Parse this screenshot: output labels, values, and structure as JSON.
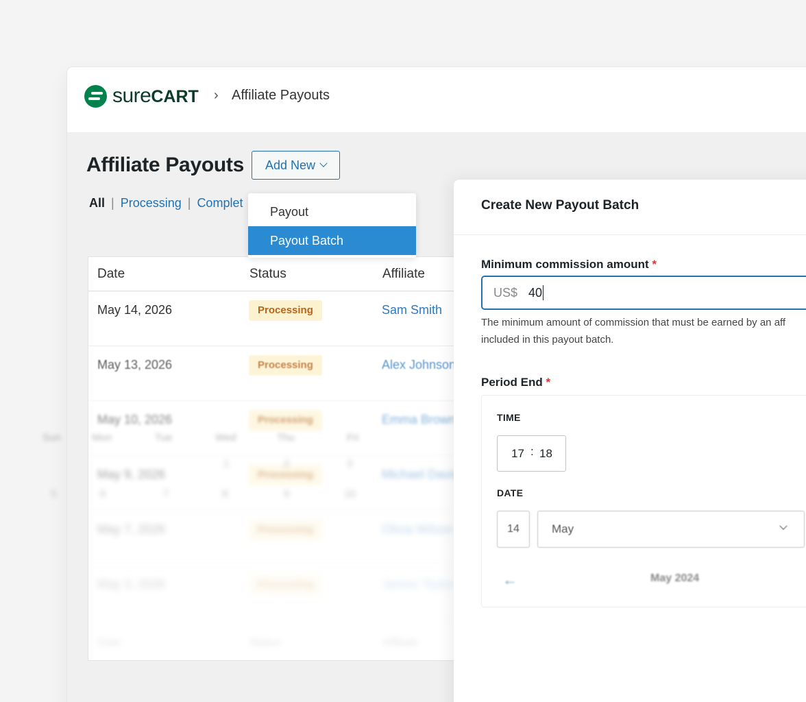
{
  "brand": {
    "name_light": "sure",
    "name_bold": "CART"
  },
  "breadcrumb": {
    "separator": "›",
    "current": "Affiliate Payouts"
  },
  "page": {
    "title": "Affiliate Payouts",
    "add_new_label": "Add New"
  },
  "filters": [
    {
      "label": "All",
      "active": true
    },
    {
      "label": "Processing",
      "active": false
    },
    {
      "label": "Complet",
      "active": false
    }
  ],
  "filter_separator": "|",
  "dropdown": {
    "items": [
      {
        "label": "Payout",
        "selected": false
      },
      {
        "label": "Payout Batch",
        "selected": true
      }
    ]
  },
  "table": {
    "columns": [
      "Date",
      "Status",
      "Affiliate"
    ],
    "rows": [
      {
        "date": "May 14, 2026",
        "status": "Processing",
        "affiliate": "Sam Smith"
      },
      {
        "date": "May 13, 2026",
        "status": "Processing",
        "affiliate": "Alex Johnson"
      },
      {
        "date": "May 10, 2026",
        "status": "Processing",
        "affiliate": "Emma Brown"
      },
      {
        "date": "May 9, 2026",
        "status": "Processing",
        "affiliate": "Michael Davis"
      },
      {
        "date": "May 7, 2026",
        "status": "Processing",
        "affiliate": "Olivia Wilson"
      },
      {
        "date": "May 3, 2026",
        "status": "Processing",
        "affiliate": "James Taylor"
      }
    ],
    "footer": [
      "Date",
      "Status",
      "Affiliate"
    ]
  },
  "modal": {
    "title": "Create New Payout Batch",
    "min_commission": {
      "label": "Minimum commission amount",
      "required_mark": "*",
      "currency_prefix": "US$",
      "value": "40",
      "help_line1": "The minimum amount of commission that must be earned by an aff",
      "help_line2": "included in this payout batch."
    },
    "period_end": {
      "label": "Period End",
      "required_mark": "*",
      "time_label": "TIME",
      "hour": "17",
      "time_separator": ":",
      "minute": "18",
      "date_label": "DATE",
      "day": "14",
      "month": "May",
      "calendar_title": "May 2024",
      "prev_arrow": "←",
      "weekdays": [
        "Sun",
        "Mon",
        "Tue",
        "Wed",
        "Thu",
        "Fri"
      ],
      "days_row1": [
        "1",
        "2",
        "3"
      ],
      "days_row2": [
        "5",
        "6",
        "7",
        "8",
        "9",
        "10"
      ]
    }
  },
  "colors": {
    "brand_green": "#01824c",
    "link_blue": "#2271b1",
    "selected_blue": "#2a8ad2",
    "badge_bg": "#fdf2cf",
    "badge_text": "#b6651a",
    "required_red": "#d63638"
  }
}
